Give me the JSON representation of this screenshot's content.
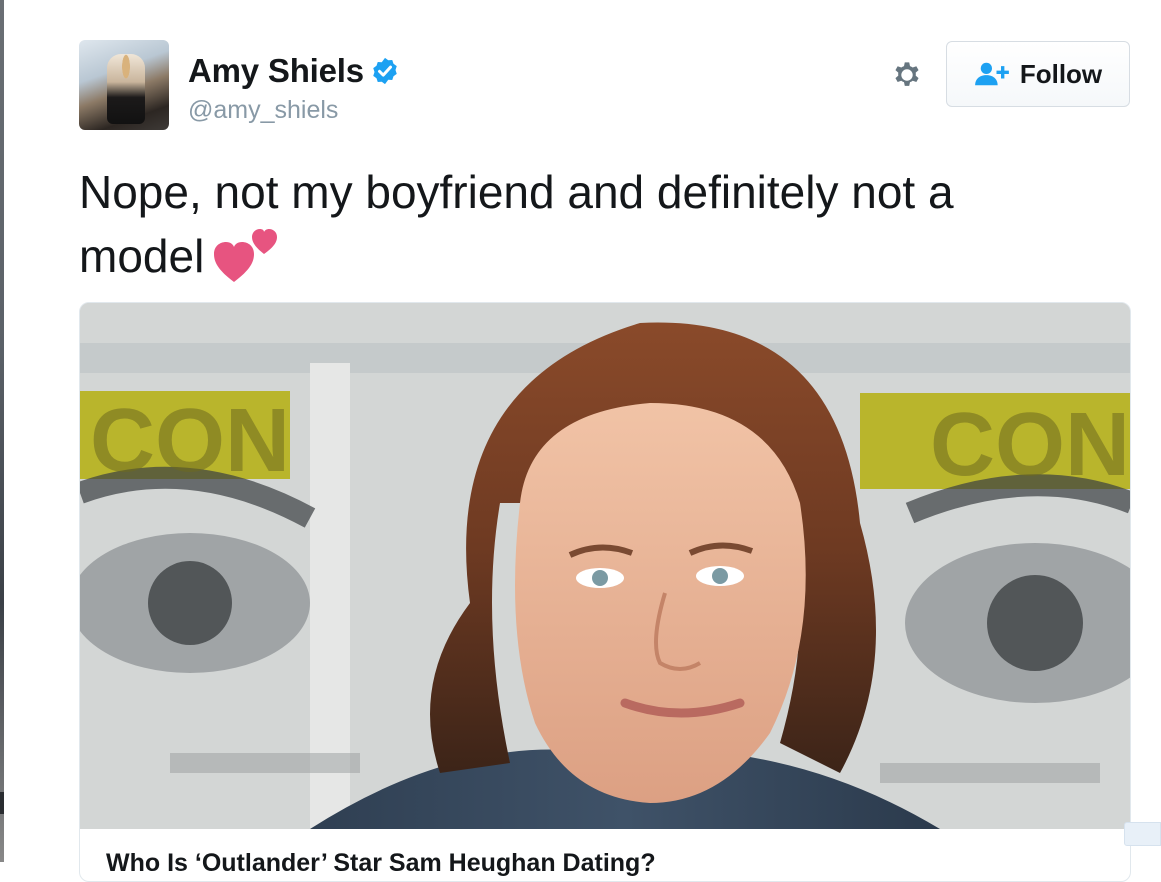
{
  "tweet": {
    "display_name": "Amy Shiels",
    "handle": "@amy_shiels",
    "text": "Nope, not my boyfriend and definitely not a model",
    "follow_label": "Follow",
    "icons": {
      "avatar": "user-avatar",
      "verified": "verified-badge-icon",
      "settings": "gear-icon",
      "follow": "add-user-icon",
      "emoji": "two-hearts-emoji"
    }
  },
  "card": {
    "title": "Who Is ‘Outlander’ Star Sam Heughan Dating?",
    "image_text": [
      "CON",
      "CON"
    ]
  },
  "colors": {
    "verified_blue": "#1da1f2",
    "handle_gray": "#8899a6",
    "heart_pink": "#e75480",
    "text": "#14171a"
  }
}
